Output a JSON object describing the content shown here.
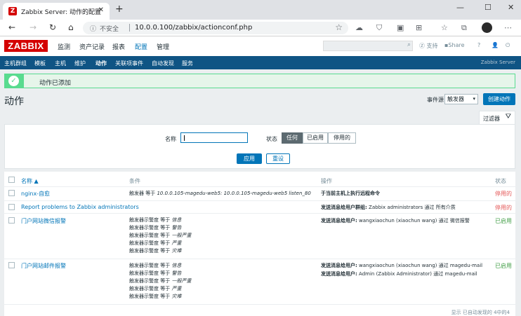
{
  "browser": {
    "tab_title": "Zabbix Server: 动作的配置",
    "tab_favicon": "Z",
    "url_insecure_label": "不安全",
    "url": "10.0.0.100/zabbix/actionconf.php"
  },
  "header": {
    "logo": "ZABBIX",
    "menu": [
      "监测",
      "资产记录",
      "报表",
      "配置",
      "管理"
    ],
    "active_menu_index": 3,
    "support_label": "支持",
    "share_label": "Share",
    "help_label": "?"
  },
  "submenu": {
    "items": [
      "主机群组",
      "模板",
      "主机",
      "维护",
      "动作",
      "关联项事件",
      "自动发现",
      "服务"
    ],
    "active_index": 4,
    "server_name": "Zabbix Server"
  },
  "message": {
    "text": "动作已添加"
  },
  "page": {
    "title": "动作",
    "event_source_label": "事件源",
    "event_source_value": "触发器",
    "create_button": "创建动作"
  },
  "filter": {
    "tab_label": "过滤器",
    "name_label": "名称",
    "name_value": "",
    "status_label": "状态",
    "status_options": [
      "任何",
      "已启用",
      "停用的"
    ],
    "status_selected_index": 0,
    "apply_label": "应用",
    "reset_label": "重设"
  },
  "table": {
    "headers": {
      "name": "名称 ▲",
      "conditions": "条件",
      "operations": "操作",
      "status": "状态"
    },
    "rows": [
      {
        "name": "nginx-自愈",
        "conditions": [
          {
            "pre": "触发器 等于 ",
            "val": "10.0.0.105-magedu-web5: 10.0.0.105-magedu-web5 listen_80"
          }
        ],
        "operations": [
          {
            "bold": "于当前主机上执行远程命令",
            "rest": ""
          }
        ],
        "status": "停用的",
        "status_type": "disabled"
      },
      {
        "name": "Report problems to Zabbix administrators",
        "conditions": [],
        "operations": [
          {
            "bold": "发送消息给用户群组:",
            "rest": " Zabbix administrators 通过 所有介质"
          }
        ],
        "status": "停用的",
        "status_type": "disabled"
      },
      {
        "name": "门户网站微信报警",
        "conditions": [
          {
            "pre": "触发器示警度 等于 ",
            "val": "信息"
          },
          {
            "pre": "触发器示警度 等于 ",
            "val": "警告"
          },
          {
            "pre": "触发器示警度 等于 ",
            "val": "一般严重"
          },
          {
            "pre": "触发器示警度 等于 ",
            "val": "严重"
          },
          {
            "pre": "触发器示警度 等于 ",
            "val": "灾难"
          }
        ],
        "operations": [
          {
            "bold": "发送消息给用户:",
            "rest": " wangxiaochun (xiaochun wang) 通过 微信报警"
          }
        ],
        "status": "已启用",
        "status_type": "enabled"
      },
      {
        "name": "门户网站邮件报警",
        "conditions": [
          {
            "pre": "触发器示警度 等于 ",
            "val": "信息"
          },
          {
            "pre": "触发器示警度 等于 ",
            "val": "警告"
          },
          {
            "pre": "触发器示警度 等于 ",
            "val": "一般严重"
          },
          {
            "pre": "触发器示警度 等于 ",
            "val": "严重"
          },
          {
            "pre": "触发器示警度 等于 ",
            "val": "灾难"
          }
        ],
        "operations": [
          {
            "bold": "发送消息给用户:",
            "rest": " wangxiaochun (xiaochun wang) 通过 magedu-mail"
          },
          {
            "bold": "发送消息给用户:",
            "rest": " Admin (Zabbix Administrator) 通过 magedu-mail"
          }
        ],
        "status": "已启用",
        "status_type": "enabled"
      }
    ],
    "footer": "显示 已自动发现的 4中的4"
  },
  "colors": {
    "zabbix_red": "#d40000",
    "primary_blue": "#0275b8",
    "subnav_blue": "#0f5484",
    "success_green": "#59db8f",
    "disabled_red": "#e45959",
    "enabled_green": "#429e47"
  }
}
